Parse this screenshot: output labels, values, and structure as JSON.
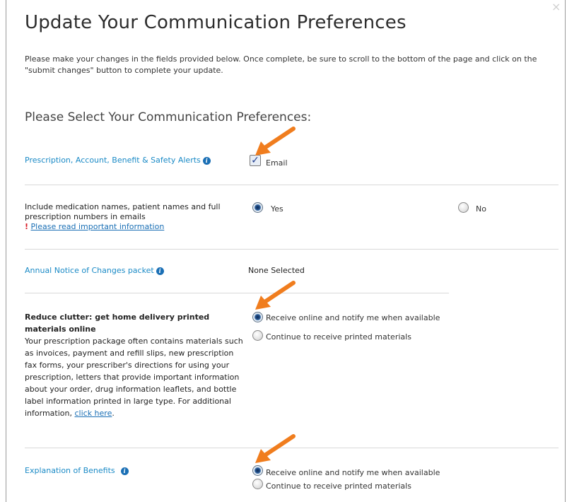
{
  "title": "Update Your Communication Preferences",
  "intro": "Please make your changes in the fields provided below. Once complete, be sure to scroll to the bottom of the page and click on the \"submit changes\" button to complete your update.",
  "section_heading": "Please Select Your Communication Preferences:",
  "close_glyph": "×",
  "alerts": {
    "label": "Prescription, Account, Benefit & Safety Alerts",
    "email_label": "Email",
    "email_checked": true
  },
  "include_names": {
    "label": "Include medication names, patient names and full prescription numbers in emails",
    "important_mark": "!",
    "important_link": "Please read important information",
    "yes_label": "Yes",
    "no_label": "No",
    "selected": "Yes"
  },
  "annual_notice": {
    "label": "Annual Notice of Changes packet",
    "value": "None Selected"
  },
  "reduce_clutter": {
    "heading": "Reduce clutter: get home delivery printed materials online",
    "description": "Your prescription package often contains materials such as invoices, payment and refill slips, new prescription fax forms, your prescriber's directions for using your prescription, letters that provide important information about your order, drug information leaflets, and bottle label information printed in large type. For additional information,",
    "link": "click here",
    "link_suffix": ".",
    "option_online": "Receive online and notify me when available",
    "option_printed": "Continue to receive printed materials",
    "selected": "online"
  },
  "eob": {
    "label": "Explanation of Benefits",
    "option_online": "Receive online and notify me when available",
    "option_printed": "Continue to receive printed materials",
    "selected": "online"
  },
  "colors": {
    "accent_blue": "#1a8ac6",
    "link_blue": "#1a6fb5",
    "arrow_orange": "#f07d1e",
    "warning_red": "#d9202a"
  },
  "icons": [
    "info-icon",
    "checkbox-checked-icon",
    "radio-selected-icon",
    "radio-unselected-icon",
    "annotation-arrow-icon",
    "close-icon"
  ]
}
